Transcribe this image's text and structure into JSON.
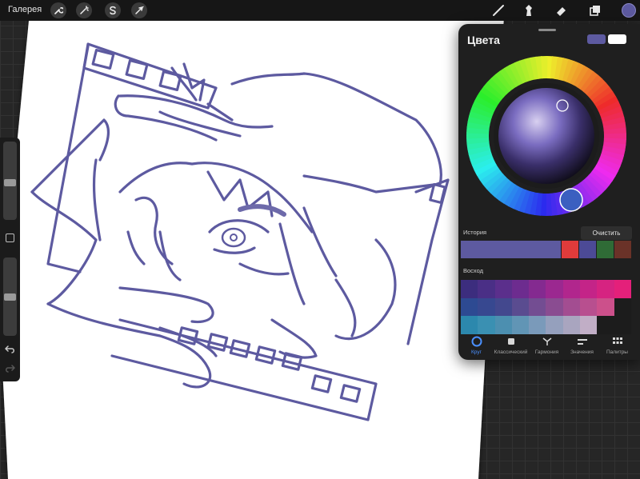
{
  "topbar": {
    "gallery_label": "Галерея",
    "tools_left": [
      "wrench-icon",
      "magic-wand-icon",
      "selection-s-icon",
      "transform-arrow-icon"
    ],
    "tools_right": [
      "brush-icon",
      "smudge-icon",
      "eraser-icon",
      "layers-icon",
      "color-dot"
    ],
    "current_color": "#5d5aa0"
  },
  "colors_panel": {
    "title": "Цвета",
    "primary_color": "#5d5aa0",
    "secondary_color": "#ffffff",
    "history": {
      "label": "История",
      "clear_label": "Очистить",
      "colors": [
        "#5d5aa0",
        "#e03b3b",
        "#4c4a96",
        "#2f6b36",
        "#6a3228"
      ]
    },
    "palette": {
      "label": "Восход",
      "rows": [
        [
          "#3c2d7e",
          "#4a2f86",
          "#5b2f8c",
          "#6d2c8f",
          "#842a90",
          "#9b2890",
          "#b1268d",
          "#c42488",
          "#d62381",
          "#e4207a"
        ],
        [
          "#2d4a92",
          "#374890",
          "#43488e",
          "#5a4c90",
          "#734d92",
          "#8a4c91",
          "#a34d91",
          "#b84f8f",
          "#cc508b",
          "#1c1c1c"
        ],
        [
          "#2c88ad",
          "#3a90b2",
          "#4c8fb0",
          "#6195b5",
          "#7a9aba",
          "#95a0bd",
          "#a9a5bf",
          "#c1aec6",
          "#1c1c1c",
          "#1c1c1c"
        ]
      ]
    },
    "tabs": [
      {
        "label": "Круг",
        "icon": "disc-icon",
        "active": true
      },
      {
        "label": "Классический",
        "icon": "square-icon",
        "active": false
      },
      {
        "label": "Гармония",
        "icon": "harmony-icon",
        "active": false
      },
      {
        "label": "Значения",
        "icon": "sliders-icon",
        "active": false
      },
      {
        "label": "Палитры",
        "icon": "grid-icon",
        "active": false
      }
    ]
  },
  "sidebar": {
    "brush_size_level": 0.47,
    "opacity_level": 0.49,
    "items": [
      "brush-size-slider",
      "modify-button",
      "opacity-slider",
      "undo-icon",
      "redo-icon"
    ]
  },
  "canvas": {
    "line_color": "#5d5aa0",
    "paper_color": "#ffffff"
  }
}
